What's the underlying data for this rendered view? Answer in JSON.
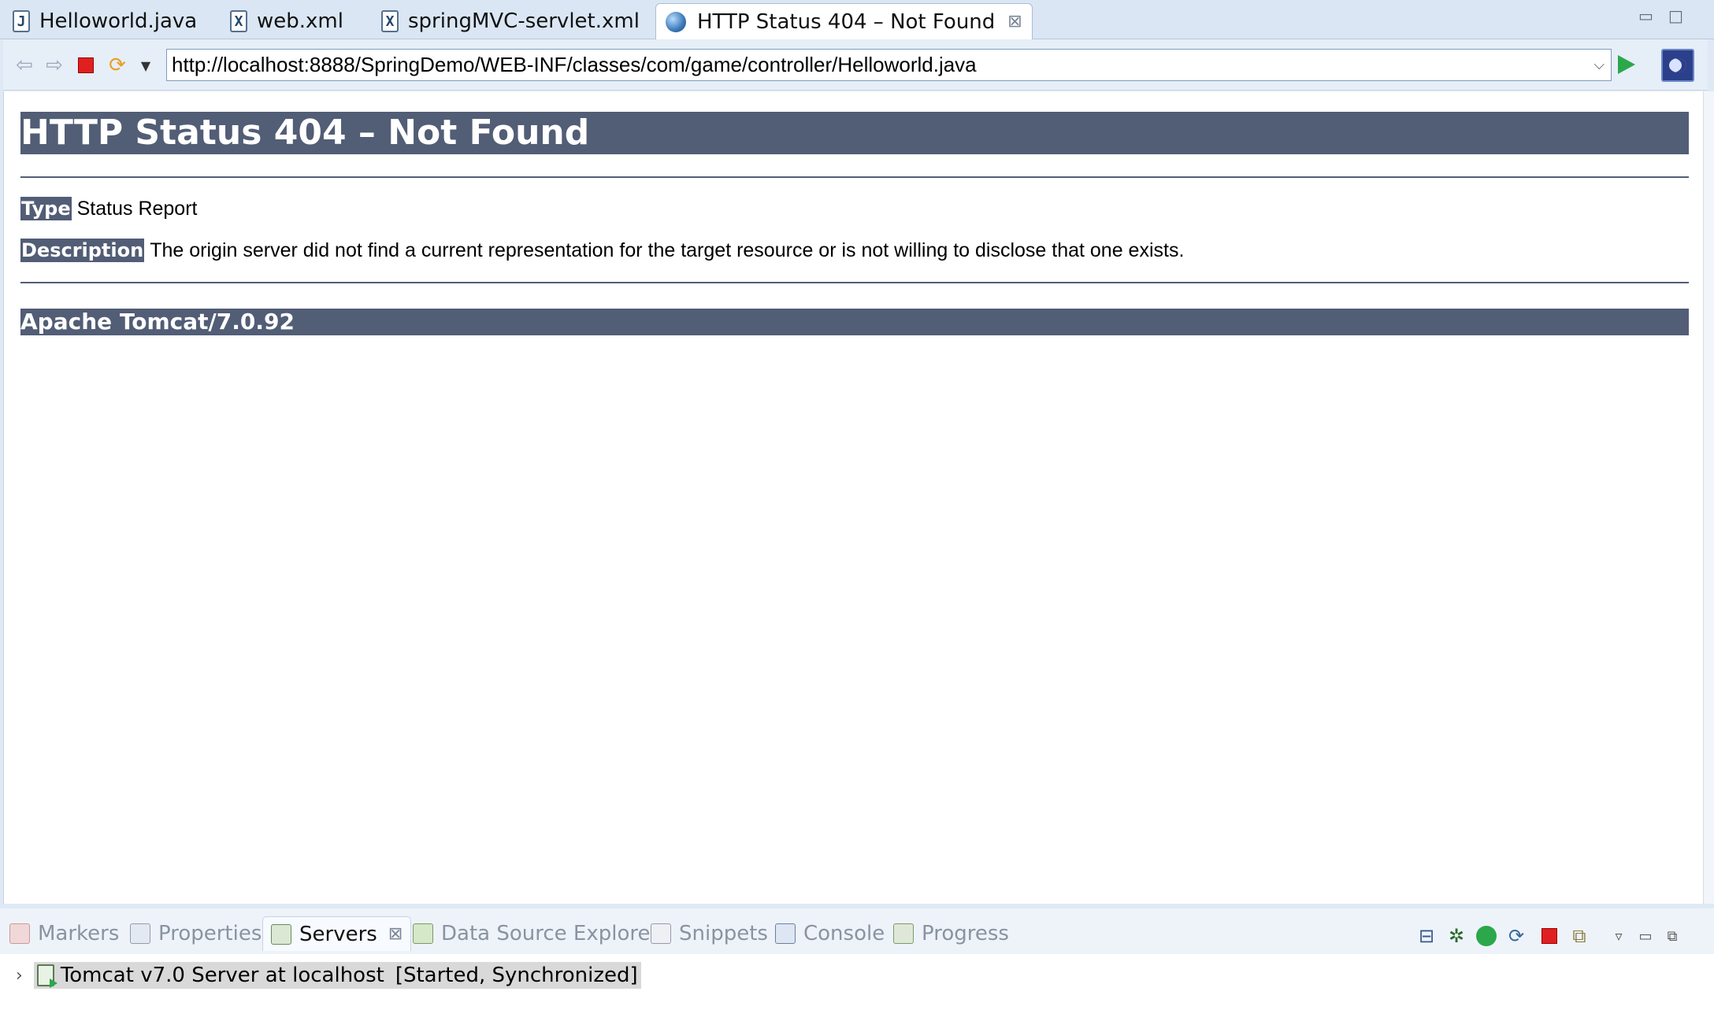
{
  "editor_tabs": [
    {
      "label": "Helloworld.java",
      "icon": "J"
    },
    {
      "label": "web.xml",
      "icon": "X"
    },
    {
      "label": "springMVC-servlet.xml",
      "icon": "X"
    },
    {
      "label": "HTTP Status 404 – Not Found",
      "icon": "globe-icon",
      "close": "⊠"
    }
  ],
  "browser": {
    "url": "http://localhost:8888/SpringDemo/WEB-INF/classes/com/game/controller/Helloworld.java"
  },
  "page": {
    "title": "HTTP Status 404 – Not Found",
    "type_label": "Type",
    "type_value": "Status Report",
    "description_label": "Description",
    "description_value": "The origin server did not find a current representation for the target resource or is not willing to disclose that one exists.",
    "server_footer": "Apache Tomcat/7.0.92",
    "header_bg": "#525d76"
  },
  "bottom_panel": {
    "tabs": [
      {
        "label": "Markers",
        "active": false
      },
      {
        "label": "Properties",
        "active": false
      },
      {
        "label": "Servers",
        "active": true
      },
      {
        "label": "Data Source Explorer",
        "active": false
      },
      {
        "label": "Snippets",
        "active": false
      },
      {
        "label": "Console",
        "active": false
      },
      {
        "label": "Progress",
        "active": false
      }
    ],
    "servers": [
      {
        "name": "Tomcat v7.0 Server at localhost",
        "status": "[Started, Synchronized]"
      }
    ]
  }
}
